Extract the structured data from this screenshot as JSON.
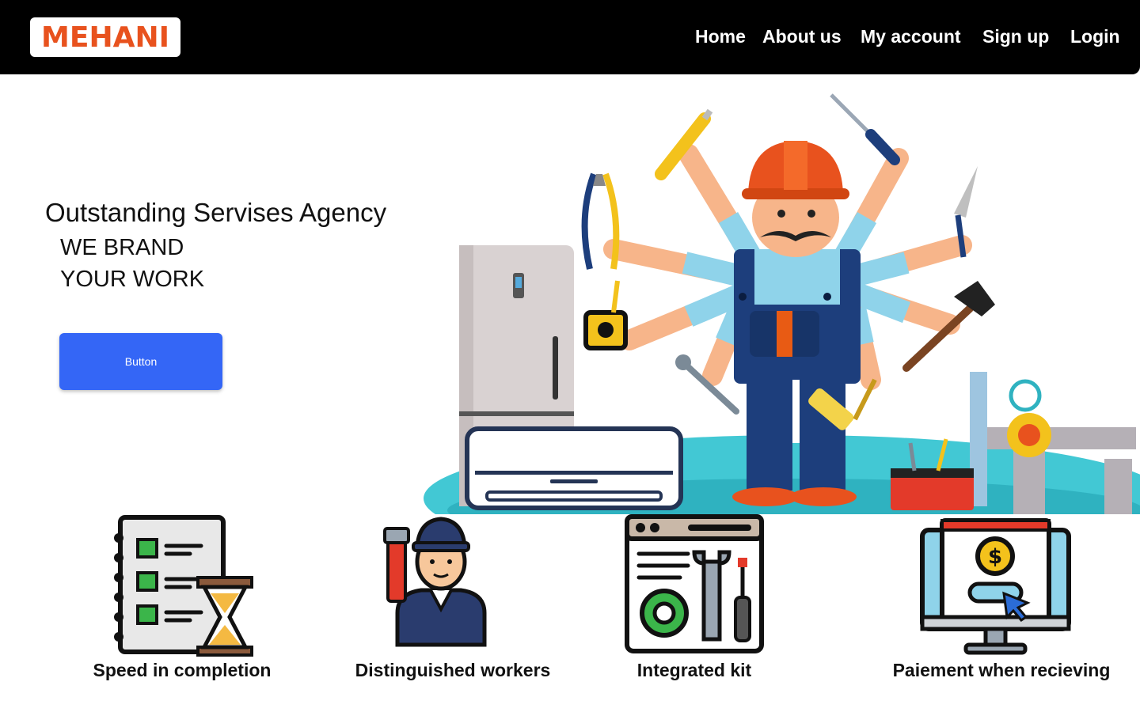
{
  "header": {
    "logo": "MEHANI",
    "nav": [
      "Home",
      "About us",
      "My account",
      "Sign up",
      "Login"
    ]
  },
  "hero": {
    "title": "Outstanding Servises Agency",
    "line1": "WE BRAND",
    "line2": "YOUR WORK",
    "button_label": "Button"
  },
  "features": [
    {
      "label": "Speed in completion",
      "icon": "checklist-hourglass-icon"
    },
    {
      "label": "Distinguished workers",
      "icon": "plumber-worker-icon"
    },
    {
      "label": "Integrated kit",
      "icon": "toolkit-gear-icon"
    },
    {
      "label": "Paiement when recieving",
      "icon": "payment-monitor-icon"
    }
  ],
  "colors": {
    "header_bg": "#000000",
    "logo": "#e8521e",
    "button": "#3466f6"
  }
}
